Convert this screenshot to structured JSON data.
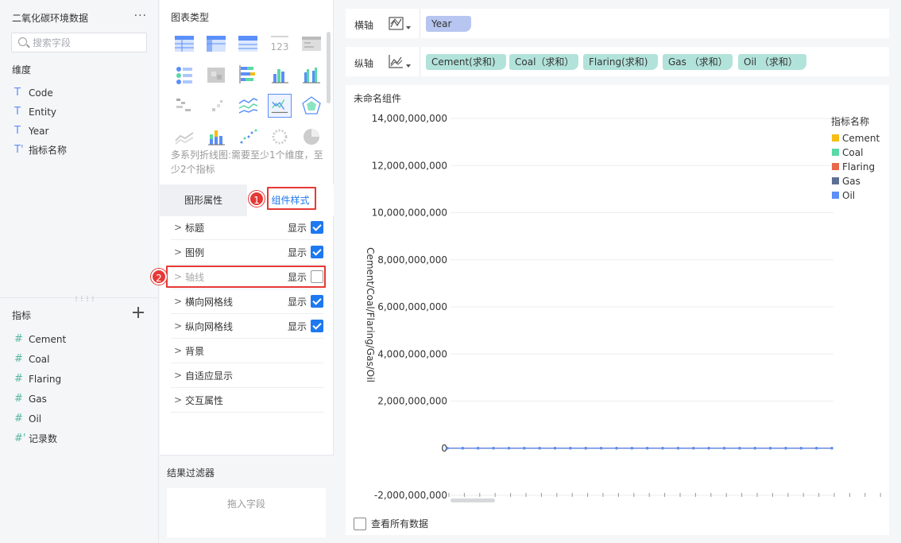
{
  "left": {
    "dataset_title": "二氧化碳环境数据",
    "more": "···",
    "search_placeholder": "搜索字段",
    "dimensions_title": "维度",
    "dimensions": [
      {
        "type": "T",
        "label": "Code"
      },
      {
        "type": "T",
        "label": "Entity"
      },
      {
        "type": "T",
        "label": "Year"
      },
      {
        "type": "T'",
        "label": "指标名称"
      }
    ],
    "measures_title": "指标",
    "measures": [
      {
        "type": "#",
        "label": "Cement"
      },
      {
        "type": "#",
        "label": "Coal"
      },
      {
        "type": "#",
        "label": "Flaring"
      },
      {
        "type": "#",
        "label": "Gas"
      },
      {
        "type": "#",
        "label": "Oil"
      },
      {
        "type": "#'",
        "label": "记录数"
      }
    ]
  },
  "middle": {
    "chart_type_title": "图表类型",
    "chart_types": [
      "table-icon",
      "cross-table-icon",
      "grouped-table-icon",
      "kpi-number-icon",
      "detail-table-icon",
      "indicator-card-icon",
      "heat-table-icon",
      "stacked-bar-icon",
      "column-icon",
      "grouped-column-icon",
      "waterfall-icon",
      "scatter-small-icon",
      "multi-line-icon",
      "multi-series-line-icon",
      "radar-icon",
      "area-icon",
      "stacked-column-icon",
      "scatter-icon",
      "dot-ring-icon",
      "pie-icon"
    ],
    "selected_chart_type": "multi-series-line-icon",
    "description": "多系列折线图:需要至少1个维度，至少2个指标",
    "tab_properties": "图形属性",
    "tab_style": "组件样式",
    "badge_1": "1",
    "badge_2": "2",
    "show_label": "显示",
    "style_items": [
      {
        "label": "标题",
        "has_toggle": true,
        "checked": true,
        "disabled": false
      },
      {
        "label": "图例",
        "has_toggle": true,
        "checked": true,
        "disabled": false
      },
      {
        "label": "轴线",
        "has_toggle": true,
        "checked": false,
        "disabled": true
      },
      {
        "label": "横向网格线",
        "has_toggle": true,
        "checked": true,
        "disabled": false
      },
      {
        "label": "纵向网格线",
        "has_toggle": true,
        "checked": true,
        "disabled": false
      },
      {
        "label": "背景",
        "has_toggle": false
      },
      {
        "label": "自适应显示",
        "has_toggle": false
      },
      {
        "label": "交互属性",
        "has_toggle": false
      }
    ],
    "result_filter_title": "结果过滤器",
    "drop_hint": "拖入字段"
  },
  "right": {
    "x_axis_label": "横轴",
    "y_axis_label": "纵轴",
    "x_fields": [
      "Year"
    ],
    "y_fields": [
      "Cement(求和)",
      "Coal（求和）",
      "Flaring(求和)",
      "Gas （求和）",
      "Oil （求和）"
    ],
    "component_name": "未命名组件",
    "view_all_label": "查看所有数据"
  },
  "chart_data": {
    "type": "line",
    "title": "",
    "ylabel": "Cement/Coal/Flaring/Gas/Oil",
    "xlabel": "",
    "ylim": [
      -2000000000,
      14000000000
    ],
    "y_ticks": [
      "14,000,000,000",
      "12,000,000,000",
      "10,000,000,000",
      "8,000,000,000",
      "6,000,000,000",
      "4,000,000,000",
      "2,000,000,000",
      "0",
      "-2,000,000,000"
    ],
    "y_tick_values": [
      14000000000,
      12000000000,
      10000000000,
      8000000000,
      6000000000,
      4000000000,
      2000000000,
      0,
      -2000000000
    ],
    "legend_title": "指标名称",
    "legend_position": "top-right",
    "grid_horizontal": true,
    "series": [
      {
        "name": "Cement",
        "color": "#f6bd16",
        "values": [
          0,
          0,
          0,
          0,
          0,
          0,
          0,
          0,
          0,
          0,
          0,
          0,
          0,
          0,
          0,
          0,
          0,
          0,
          0,
          0,
          0,
          0,
          0,
          0,
          0,
          0
        ]
      },
      {
        "name": "Coal",
        "color": "#5ad8a6",
        "values": [
          0,
          0,
          0,
          0,
          0,
          0,
          0,
          0,
          0,
          0,
          0,
          0,
          0,
          0,
          0,
          0,
          0,
          0,
          0,
          0,
          0,
          0,
          0,
          0,
          0,
          0
        ]
      },
      {
        "name": "Flaring",
        "color": "#e8684a",
        "values": [
          0,
          0,
          0,
          0,
          0,
          0,
          0,
          0,
          0,
          0,
          0,
          0,
          0,
          0,
          0,
          0,
          0,
          0,
          0,
          0,
          0,
          0,
          0,
          0,
          0,
          0
        ]
      },
      {
        "name": "Gas",
        "color": "#5d7092",
        "values": [
          0,
          0,
          0,
          0,
          0,
          0,
          0,
          0,
          0,
          0,
          0,
          0,
          0,
          0,
          0,
          0,
          0,
          0,
          0,
          0,
          0,
          0,
          0,
          0,
          0,
          0
        ]
      },
      {
        "name": "Oil",
        "color": "#5b8ff9",
        "values": [
          0,
          0,
          0,
          0,
          0,
          0,
          0,
          0,
          0,
          0,
          0,
          0,
          0,
          0,
          0,
          0,
          0,
          0,
          0,
          0,
          0,
          0,
          0,
          0,
          0,
          0
        ]
      }
    ]
  }
}
